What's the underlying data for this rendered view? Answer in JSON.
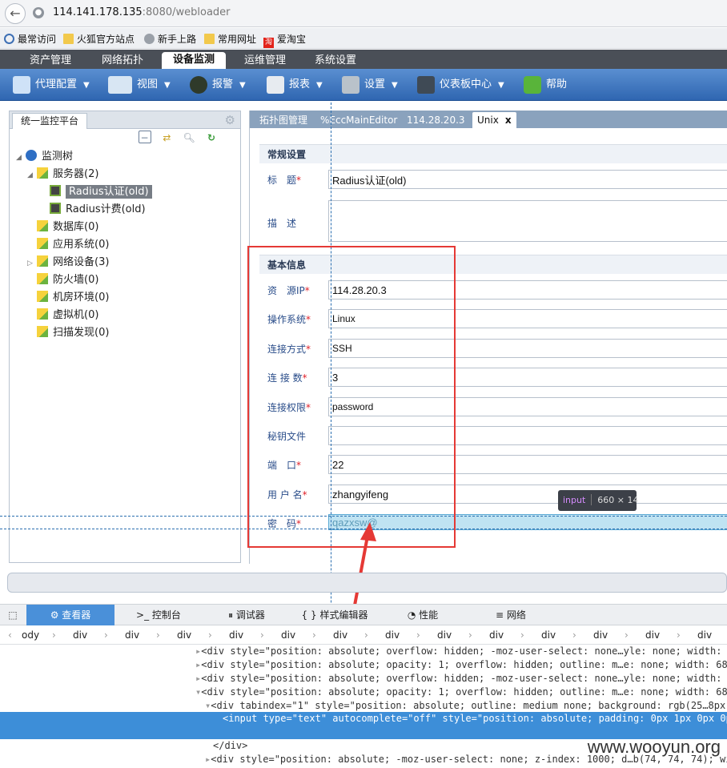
{
  "browser": {
    "back": "←",
    "url_host": "114.141.178.135",
    "url_rest": ":8080/webloader",
    "bookmarks": [
      "最常访问",
      "火狐官方站点",
      "新手上路",
      "常用网址",
      "爱淘宝"
    ]
  },
  "app_tabs": [
    "资产管理",
    "网络拓扑",
    "设备监测",
    "运维管理",
    "系统设置"
  ],
  "toolbar": [
    "代理配置",
    "视图",
    "报警",
    "报表",
    "设置",
    "仪表板中心",
    "帮助"
  ],
  "left_panel": {
    "tab": "统一监控平台",
    "tree": {
      "root": "监测树",
      "servers": "服务器(2)",
      "server_children": [
        "Radius认证(old)",
        "Radius计费(old)"
      ],
      "groups": [
        "数据库(0)",
        "应用系统(0)",
        "网络设备(3)",
        "防火墙(0)",
        "机房环境(0)",
        "虚拟机(0)",
        "扫描发现(0)"
      ]
    }
  },
  "right_panel": {
    "tabs": [
      "拓扑图管理",
      "%EccMainEditor",
      "114.28.20.3",
      "Unix"
    ],
    "close": "x",
    "general_header": "常规设置",
    "title_label": "标　题",
    "title_value": "Radius认证(old)",
    "desc_label": "描　述",
    "basic_header": "基本信息",
    "fields": [
      {
        "label": "资　源IP",
        "value": "114.28.20.3"
      },
      {
        "label": "操作系统",
        "value": "Linux"
      },
      {
        "label": "连接方式",
        "value": "SSH"
      },
      {
        "label": "连 接 数",
        "value": "3"
      },
      {
        "label": "连接权限",
        "value": "password"
      },
      {
        "label": "秘钥文件",
        "value": ""
      },
      {
        "label": "端　口",
        "value": "22"
      },
      {
        "label": "用 户 名",
        "value": "zhangyifeng"
      }
    ],
    "password_label": "密　码",
    "password_value": "qazxsw@"
  },
  "tooltip": {
    "tag": "input",
    "size": "660 × 14"
  },
  "devtools": {
    "tabs": [
      "查看器",
      "控制台",
      "调试器",
      "样式编辑器",
      "性能",
      "网络"
    ],
    "crumbs": [
      "ody",
      "div",
      "div",
      "div",
      "div",
      "div",
      "div",
      "div",
      "div",
      "div",
      "div",
      "div",
      "div",
      "div"
    ],
    "lines": [
      "<div style=\"position: absolute; overflow: hidden; -moz-user-select: none…yle: none; width: 52p",
      "<div style=\"position: absolute; opacity: 1; overflow: hidden; outline: m…e: none; width: 683px",
      "<div style=\"position: absolute; overflow: hidden; -moz-user-select: none…yle: none; width: 56p",
      "<div style=\"position: absolute; opacity: 1; overflow: hidden; outline: m…e: none; width: 683px",
      "<div tabindex=\"1\" style=\"position: absolute; outline: medium none; background: rgb(25…8px; h",
      "<input type=\"text\" autocomplete=\"off\" style=\"position: absolute; padding: 0px 1px 0px 0px; widt",
      "</div>",
      "<div style=\"position: absolute; -moz-user-select: none; z-index: 1000; d…b(74, 74, 74); widt"
    ]
  },
  "watermark": "www.wooyun.org"
}
